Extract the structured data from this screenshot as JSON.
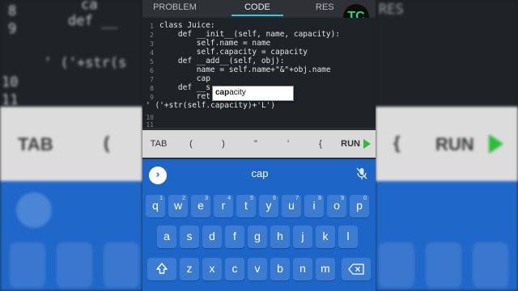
{
  "tabs": [
    {
      "label": "PROBLEM"
    },
    {
      "label": "CODE"
    },
    {
      "label": "RES"
    }
  ],
  "logo": {
    "text": "TC"
  },
  "editor": {
    "line_numbers": [
      "1",
      "2",
      "3",
      "4",
      "5",
      "6",
      "7",
      "8",
      "9",
      "",
      "10",
      "11"
    ],
    "lines": [
      "class Juice:",
      "    def __init__(self, name, capacity):",
      "        self.name = name",
      "        self.capacity = capacity",
      "    def __add__(self, obj):",
      "        name = self.name+\"&\"+obj.name",
      "        cap",
      "    def __s",
      "        ret",
      "' ('+str(self.capacity)+'L')",
      "",
      ""
    ],
    "autocomplete": {
      "match": "cap",
      "rest": "acity"
    }
  },
  "keybar": {
    "items": [
      "TAB",
      "(",
      ")",
      "\"",
      "'",
      "{"
    ],
    "run_label": "RUN"
  },
  "keyboard": {
    "suggestion": "cap",
    "row1": [
      {
        "k": "q",
        "n": "1"
      },
      {
        "k": "w",
        "n": "2"
      },
      {
        "k": "e",
        "n": "3"
      },
      {
        "k": "r",
        "n": "4"
      },
      {
        "k": "t",
        "n": "5"
      },
      {
        "k": "y",
        "n": "6"
      },
      {
        "k": "u",
        "n": "7"
      },
      {
        "k": "i",
        "n": "8"
      },
      {
        "k": "o",
        "n": "9"
      },
      {
        "k": "p",
        "n": "0"
      }
    ],
    "row2": [
      "a",
      "s",
      "d",
      "f",
      "g",
      "h",
      "j",
      "k",
      "l"
    ],
    "row3": [
      "z",
      "x",
      "c",
      "v",
      "b",
      "n",
      "m"
    ]
  },
  "backdrop": {
    "left_code": [
      "   ca",
      "def __",
      "",
      "' ('+str(s"
    ],
    "left_numbers": [
      "8",
      "9",
      "10",
      "11"
    ],
    "left_bar": [
      "TAB",
      "("
    ],
    "right_code": [
      "RES"
    ],
    "right_bar": [
      "{",
      "RUN"
    ]
  },
  "colors": {
    "accent": "#39c6d9",
    "keyboard": "#1d66c8",
    "run_icon": "#2ebd3a",
    "logo_text": "#23d88e"
  }
}
